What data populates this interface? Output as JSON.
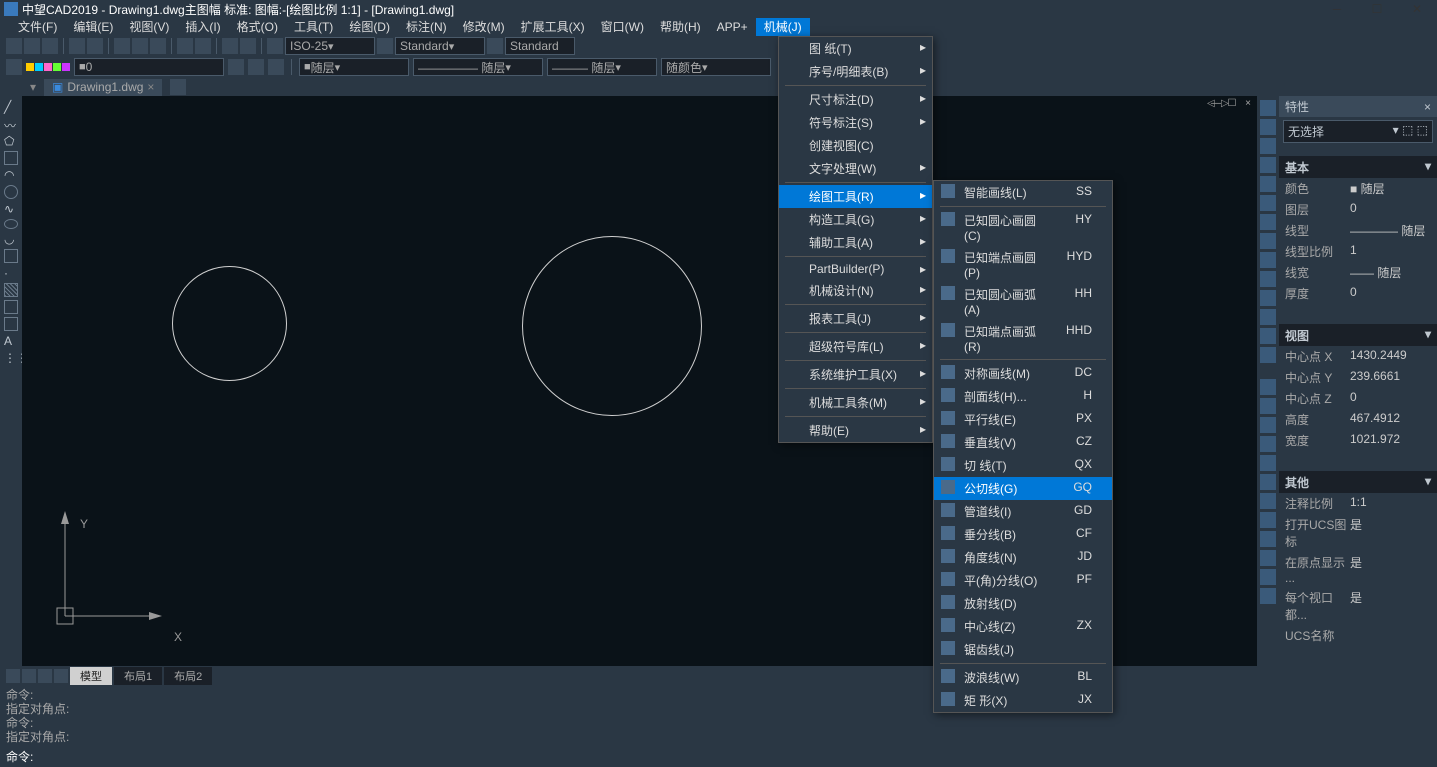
{
  "titlebar": {
    "title": "中望CAD2019 - Drawing1.dwg主图幅  标准: 图幅:-[绘图比例 1:1] - [Drawing1.dwg]"
  },
  "menubar": {
    "items": [
      {
        "label": "文件(F)"
      },
      {
        "label": "编辑(E)"
      },
      {
        "label": "视图(V)"
      },
      {
        "label": "插入(I)"
      },
      {
        "label": "格式(O)"
      },
      {
        "label": "工具(T)"
      },
      {
        "label": "绘图(D)"
      },
      {
        "label": "标注(N)"
      },
      {
        "label": "修改(M)"
      },
      {
        "label": "扩展工具(X)"
      },
      {
        "label": "窗口(W)"
      },
      {
        "label": "帮助(H)"
      },
      {
        "label": "APP+"
      },
      {
        "label": "机械(J)",
        "active": true
      }
    ]
  },
  "toolbar1": {
    "dim_style": "ISO-25",
    "text_style": "Standard",
    "table_style": "Standard"
  },
  "toolbar2": {
    "layer_num": "0",
    "layer": "随层",
    "linetype": "————— 随层",
    "lineweight": "——— 随层",
    "color": "随颜色"
  },
  "doc_tab": {
    "name": "Drawing1.dwg"
  },
  "menu1": {
    "items": [
      {
        "label": "图 纸(T)",
        "sub": true
      },
      {
        "label": "序号/明细表(B)",
        "sub": true
      },
      {
        "sep": true
      },
      {
        "label": "尺寸标注(D)",
        "sub": true
      },
      {
        "label": "符号标注(S)",
        "sub": true
      },
      {
        "label": "创建视图(C)"
      },
      {
        "label": "文字处理(W)",
        "sub": true
      },
      {
        "sep": true
      },
      {
        "label": "绘图工具(R)",
        "sub": true,
        "highlighted": true
      },
      {
        "label": "构造工具(G)",
        "sub": true
      },
      {
        "label": "辅助工具(A)",
        "sub": true
      },
      {
        "sep": true
      },
      {
        "label": "PartBuilder(P)",
        "sub": true
      },
      {
        "label": "机械设计(N)",
        "sub": true
      },
      {
        "sep": true
      },
      {
        "label": "报表工具(J)",
        "sub": true
      },
      {
        "sep": true
      },
      {
        "label": "超级符号库(L)",
        "sub": true
      },
      {
        "sep": true
      },
      {
        "label": "系统维护工具(X)",
        "sub": true
      },
      {
        "sep": true
      },
      {
        "label": "机械工具条(M)",
        "sub": true
      },
      {
        "sep": true
      },
      {
        "label": "帮助(E)",
        "sub": true
      }
    ]
  },
  "menu2": {
    "items": [
      {
        "label": "智能画线(L)",
        "shortcut": "SS"
      },
      {
        "sep": true
      },
      {
        "label": "已知圆心画圆(C)",
        "shortcut": "HY"
      },
      {
        "label": "已知端点画圆(P)",
        "shortcut": "HYD"
      },
      {
        "label": "已知圆心画弧(A)",
        "shortcut": "HH"
      },
      {
        "label": "已知端点画弧(R)",
        "shortcut": "HHD"
      },
      {
        "sep": true
      },
      {
        "label": "对称画线(M)",
        "shortcut": "DC"
      },
      {
        "label": "剖面线(H)...",
        "shortcut": "H"
      },
      {
        "label": "平行线(E)",
        "shortcut": "PX"
      },
      {
        "label": "垂直线(V)",
        "shortcut": "CZ"
      },
      {
        "label": "切 线(T)",
        "shortcut": "QX"
      },
      {
        "label": "公切线(G)",
        "shortcut": "GQ",
        "highlighted": true
      },
      {
        "label": "管道线(I)",
        "shortcut": "GD"
      },
      {
        "label": "垂分线(B)",
        "shortcut": "CF"
      },
      {
        "label": "角度线(N)",
        "shortcut": "JD"
      },
      {
        "label": "平(角)分线(O)",
        "shortcut": "PF"
      },
      {
        "label": "放射线(D)",
        "shortcut": ""
      },
      {
        "label": "中心线(Z)",
        "shortcut": "ZX"
      },
      {
        "label": "锯齿线(J)",
        "shortcut": ""
      },
      {
        "sep": true
      },
      {
        "label": "波浪线(W)",
        "shortcut": "BL"
      },
      {
        "label": "矩 形(X)",
        "shortcut": "JX"
      }
    ]
  },
  "properties": {
    "title": "特性",
    "selector": "无选择",
    "basic": {
      "title": "基本",
      "rows": [
        {
          "label": "颜色",
          "value": "■ 随层"
        },
        {
          "label": "图层",
          "value": "0"
        },
        {
          "label": "线型",
          "value": "———— 随层"
        },
        {
          "label": "线型比例",
          "value": "1"
        },
        {
          "label": "线宽",
          "value": "—— 随层"
        },
        {
          "label": "厚度",
          "value": "0"
        }
      ]
    },
    "view": {
      "title": "视图",
      "rows": [
        {
          "label": "中心点 X",
          "value": "1430.2449"
        },
        {
          "label": "中心点 Y",
          "value": "239.6661"
        },
        {
          "label": "中心点 Z",
          "value": "0"
        },
        {
          "label": "高度",
          "value": "467.4912"
        },
        {
          "label": "宽度",
          "value": "1021.972"
        }
      ]
    },
    "other": {
      "title": "其他",
      "rows": [
        {
          "label": "注释比例",
          "value": "1:1"
        },
        {
          "label": "打开UCS图标",
          "value": "是"
        },
        {
          "label": "在原点显示 ...",
          "value": "是"
        },
        {
          "label": "每个视口都...",
          "value": "是"
        },
        {
          "label": "UCS名称",
          "value": ""
        }
      ]
    }
  },
  "bottom_tabs": {
    "items": [
      {
        "label": "模型",
        "active": true
      },
      {
        "label": "布局1"
      },
      {
        "label": "布局2"
      }
    ]
  },
  "command": {
    "history": [
      "命令:",
      "指定对角点:",
      "命令:",
      "指定对角点:"
    ],
    "prompt": "命令:"
  },
  "ucs": {
    "x": "X",
    "y": "Y"
  }
}
